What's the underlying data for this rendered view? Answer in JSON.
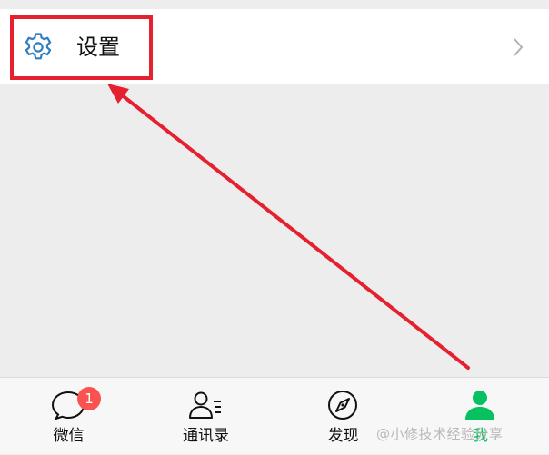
{
  "settings": {
    "label": "设置",
    "icon": "gear-icon",
    "chevron_icon": "chevron-right-icon"
  },
  "annotation": {
    "color": "#e5202f"
  },
  "tabbar": {
    "accent_color": "#07c160",
    "badge_color": "#fa5151",
    "tabs": [
      {
        "label": "微信",
        "icon": "chat-bubble-icon",
        "badge": "1"
      },
      {
        "label": "通讯录",
        "icon": "contacts-icon"
      },
      {
        "label": "发现",
        "icon": "compass-icon"
      },
      {
        "label": "我",
        "icon": "person-icon",
        "active": true
      }
    ]
  },
  "watermark": {
    "text": "@小修技术经验分享"
  }
}
